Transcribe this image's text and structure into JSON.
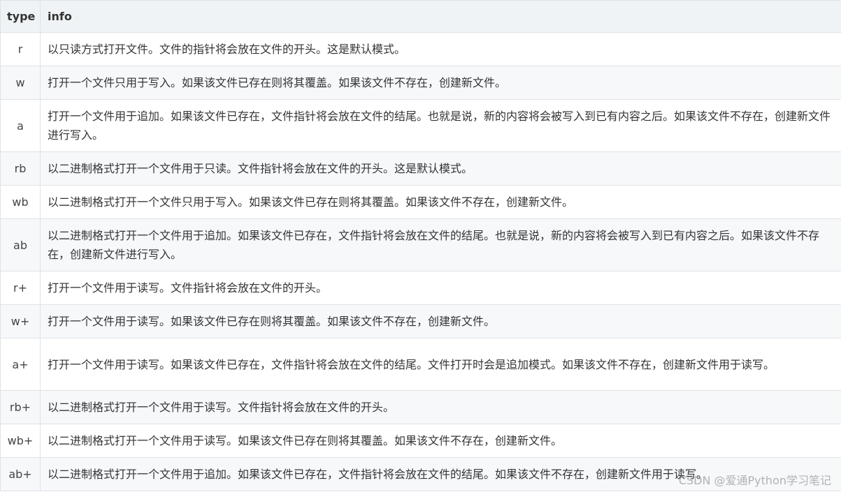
{
  "table": {
    "headers": {
      "type": "type",
      "info": "info"
    },
    "rows": [
      {
        "type": "r",
        "info": "以只读方式打开文件。文件的指针将会放在文件的开头。这是默认模式。"
      },
      {
        "type": "w",
        "info": "打开一个文件只用于写入。如果该文件已存在则将其覆盖。如果该文件不存在，创建新文件。"
      },
      {
        "type": "a",
        "info": "打开一个文件用于追加。如果该文件已存在，文件指针将会放在文件的结尾。也就是说，新的内容将会被写入到已有内容之后。如果该文件不存在，创建新文件进行写入。"
      },
      {
        "type": "rb",
        "info": "以二进制格式打开一个文件用于只读。文件指针将会放在文件的开头。这是默认模式。"
      },
      {
        "type": "wb",
        "info": "以二进制格式打开一个文件只用于写入。如果该文件已存在则将其覆盖。如果该文件不存在，创建新文件。"
      },
      {
        "type": "ab",
        "info": "以二进制格式打开一个文件用于追加。如果该文件已存在，文件指针将会放在文件的结尾。也就是说，新的内容将会被写入到已有内容之后。如果该文件不存在，创建新文件进行写入。"
      },
      {
        "type": "r+",
        "info": "打开一个文件用于读写。文件指针将会放在文件的开头。"
      },
      {
        "type": "w+",
        "info": "打开一个文件用于读写。如果该文件已存在则将其覆盖。如果该文件不存在，创建新文件。"
      },
      {
        "type": "a+",
        "info": "打开一个文件用于读写。如果该文件已存在，文件指针将会放在文件的结尾。文件打开时会是追加模式。如果该文件不存在，创建新文件用于读写。"
      },
      {
        "type": "rb+",
        "info": "以二进制格式打开一个文件用于读写。文件指针将会放在文件的开头。"
      },
      {
        "type": "wb+",
        "info": "以二进制格式打开一个文件用于读写。如果该文件已存在则将其覆盖。如果该文件不存在，创建新文件。"
      },
      {
        "type": "ab+",
        "info": "以二进制格式打开一个文件用于追加。如果该文件已存在，文件指针将会放在文件的结尾。如果该文件不存在，创建新文件用于读写。"
      }
    ]
  },
  "watermark": "CSDN @爱通Python学习笔记"
}
